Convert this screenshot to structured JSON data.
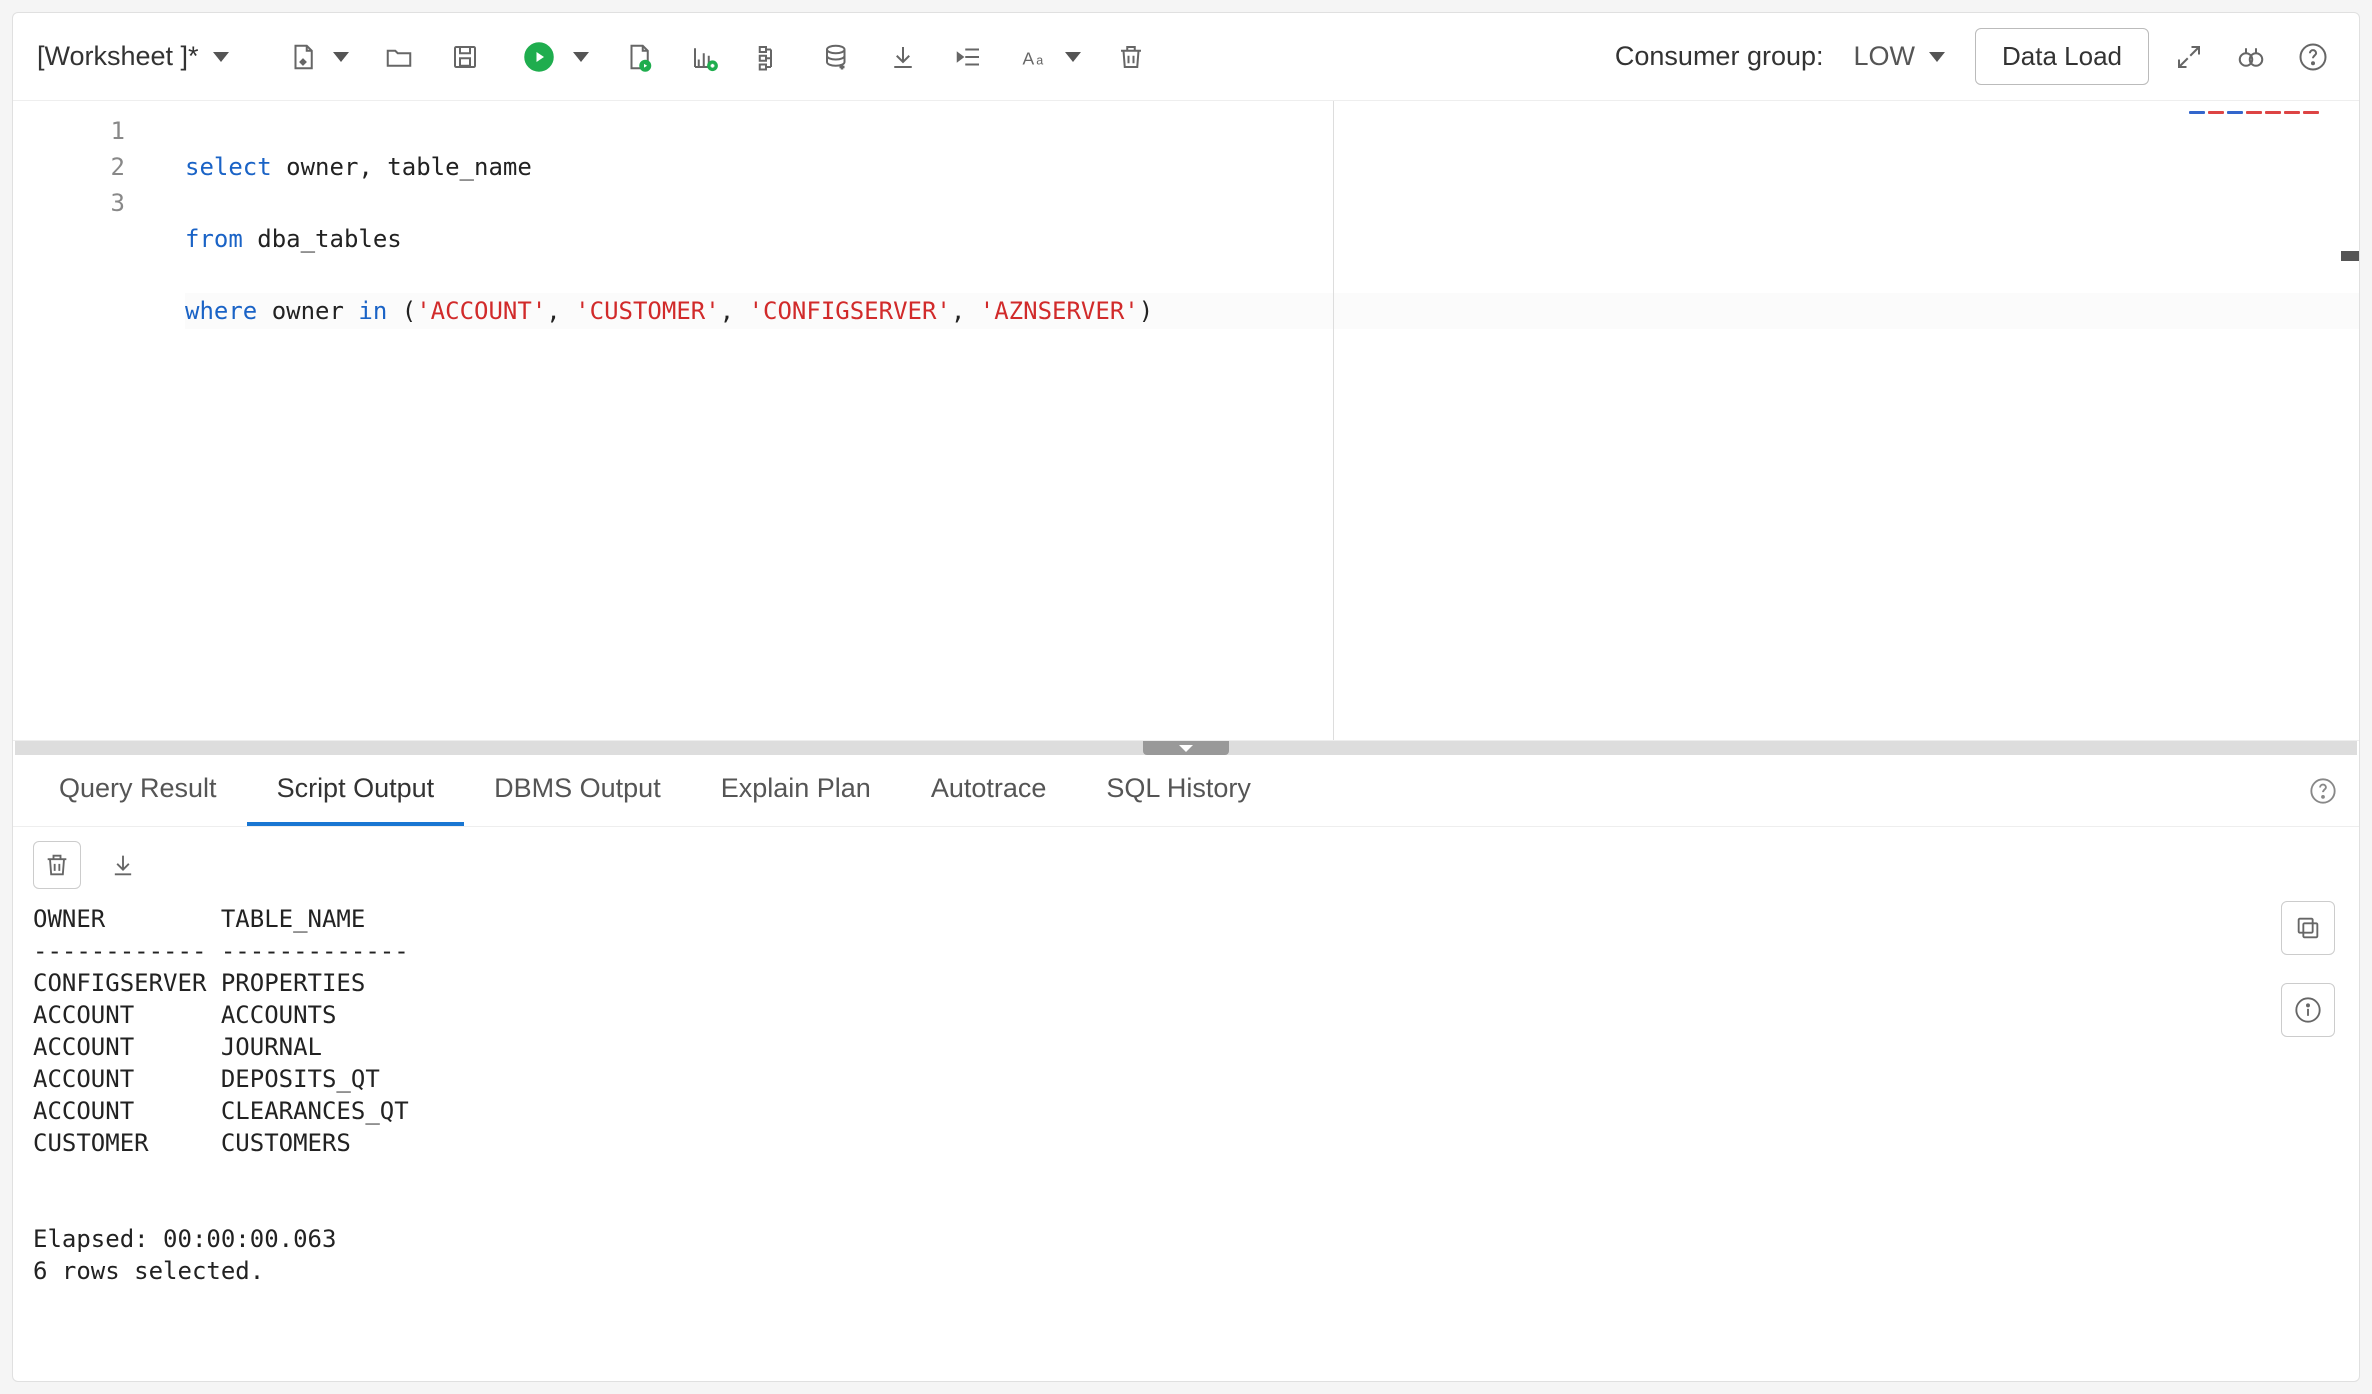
{
  "worksheet": {
    "title": "[Worksheet ]*"
  },
  "consumer": {
    "label": "Consumer group:",
    "value": "LOW"
  },
  "buttons": {
    "data_load": "Data Load"
  },
  "editor": {
    "lines": [
      {
        "num": "1"
      },
      {
        "num": "2"
      },
      {
        "num": "3"
      }
    ],
    "sql": {
      "l1_kw1": "select",
      "l1_id1": " owner",
      "l1_txt1": ", table_name",
      "l2_kw1": "from",
      "l2_id1": " dba_tables",
      "l3_kw1": "where",
      "l3_id1": " owner ",
      "l3_kw2": "in",
      "l3_p1": " (",
      "l3_s1": "'ACCOUNT'",
      "l3_c1": ", ",
      "l3_s2": "'CUSTOMER'",
      "l3_c2": ", ",
      "l3_s3": "'CONFIGSERVER'",
      "l3_c3": ", ",
      "l3_s4": "'AZNSERVER'",
      "l3_p2": ")"
    }
  },
  "tabs": [
    {
      "label": "Query Result",
      "active": false
    },
    {
      "label": "Script Output",
      "active": true
    },
    {
      "label": "DBMS Output",
      "active": false
    },
    {
      "label": "Explain Plan",
      "active": false
    },
    {
      "label": "Autotrace",
      "active": false
    },
    {
      "label": "SQL History",
      "active": false
    }
  ],
  "output": {
    "header_owner": "OWNER",
    "header_table": "TABLE_NAME",
    "rows": [
      {
        "owner": "CONFIGSERVER",
        "table": "PROPERTIES"
      },
      {
        "owner": "ACCOUNT",
        "table": "ACCOUNTS"
      },
      {
        "owner": "ACCOUNT",
        "table": "JOURNAL"
      },
      {
        "owner": "ACCOUNT",
        "table": "DEPOSITS_QT"
      },
      {
        "owner": "ACCOUNT",
        "table": "CLEARANCES_QT"
      },
      {
        "owner": "CUSTOMER",
        "table": "CUSTOMERS"
      }
    ],
    "elapsed": "Elapsed: 00:00:00.063",
    "rows_selected": "6 rows selected."
  }
}
